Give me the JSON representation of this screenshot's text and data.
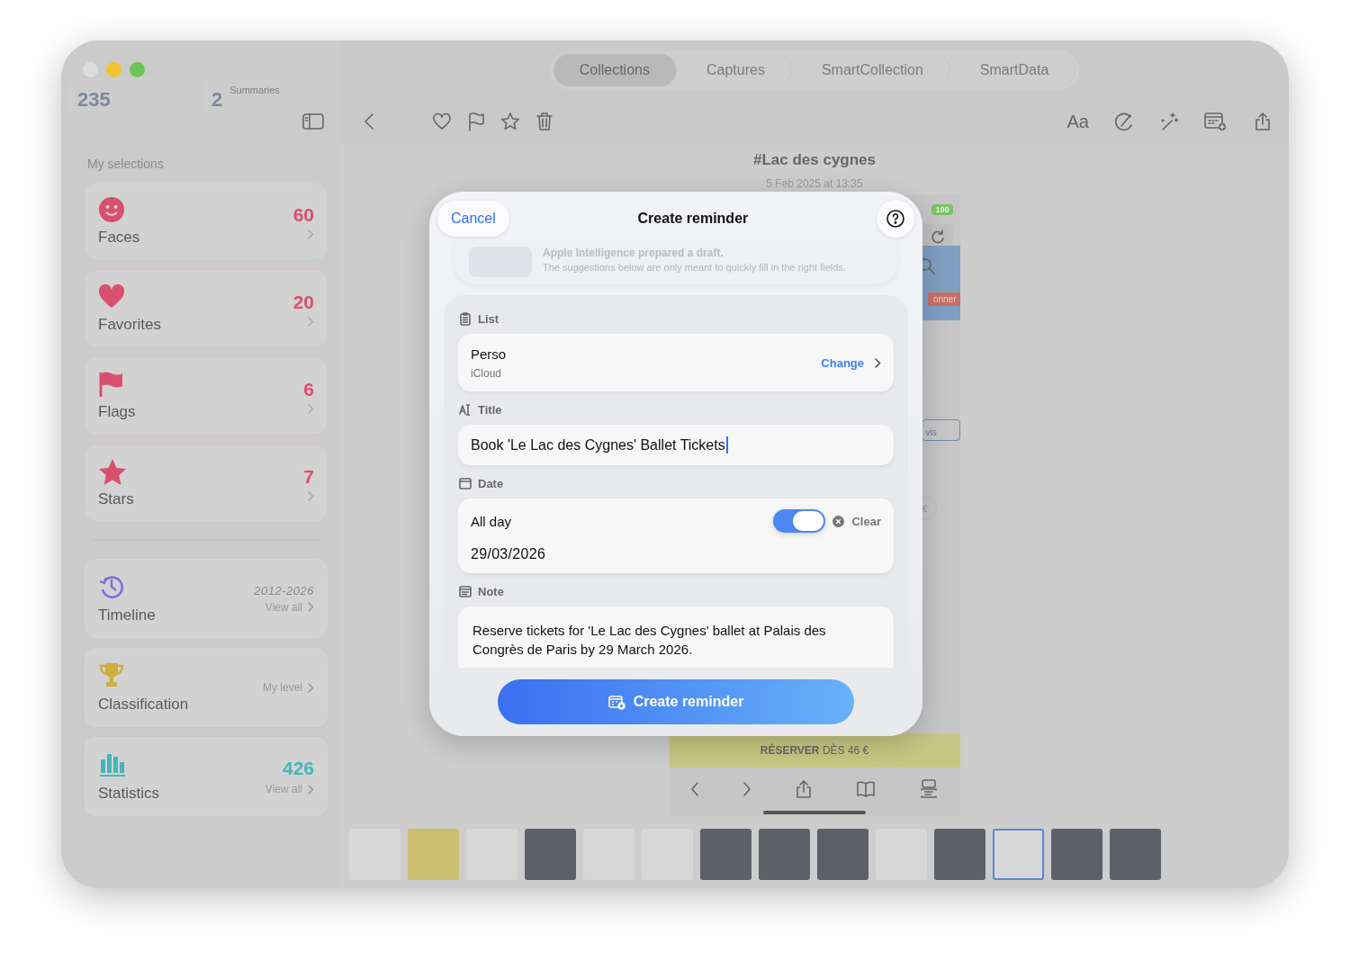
{
  "sidebar": {
    "stats": [
      {
        "value": "235"
      },
      {
        "label": "Summaries",
        "value": "2"
      }
    ],
    "section_title": "My selections",
    "selections": [
      {
        "label": "Faces",
        "count": "60",
        "kind": "smiley",
        "color": "#d9506e"
      },
      {
        "label": "Favorites",
        "count": "20",
        "kind": "heart",
        "color": "#d9506e"
      },
      {
        "label": "Flags",
        "count": "6",
        "kind": "flag",
        "color": "#d9506e"
      },
      {
        "label": "Stars",
        "count": "7",
        "kind": "star",
        "color": "#d9506e"
      }
    ],
    "tools": [
      {
        "label": "Timeline",
        "detail": "2012-2026",
        "link": "View all",
        "kind": "clock",
        "color": "#7d6fd8"
      },
      {
        "label": "Classification",
        "link": "My level",
        "kind": "trophy",
        "color": "#cfae3c"
      },
      {
        "label": "Statistics",
        "count": "426",
        "link": "View all",
        "kind": "bars",
        "color": "#45b5ba"
      }
    ]
  },
  "tabs": [
    {
      "label": "Collections",
      "selected": true
    },
    {
      "label": "Captures",
      "selected": false
    },
    {
      "label": "SmartCollection",
      "selected": false
    },
    {
      "label": "SmartData",
      "selected": false
    }
  ],
  "toolbar": {
    "text_size_label": "Aa"
  },
  "document": {
    "title": "#Lac des cygnes",
    "date": "5 Feb 2025 at 13:35"
  },
  "preview": {
    "badge": "100",
    "button_fragment": "onner",
    "link_fragment": "vis",
    "price_fragment": "€",
    "banner": "**RÉSERVER** DÈS 46 €"
  },
  "thumbnails": [
    {
      "kind": "light",
      "selected": false
    },
    {
      "kind": "yellow",
      "selected": false
    },
    {
      "kind": "light",
      "selected": false
    },
    {
      "kind": "dark",
      "selected": false
    },
    {
      "kind": "light",
      "selected": false
    },
    {
      "kind": "light",
      "selected": false
    },
    {
      "kind": "dark",
      "selected": false
    },
    {
      "kind": "dark",
      "selected": false
    },
    {
      "kind": "dark",
      "selected": false
    },
    {
      "kind": "light",
      "selected": false
    },
    {
      "kind": "dark",
      "selected": false
    },
    {
      "kind": "light",
      "selected": true
    },
    {
      "kind": "dark",
      "selected": false
    },
    {
      "kind": "dark",
      "selected": false
    }
  ],
  "dialog": {
    "cancel": "Cancel",
    "title": "Create reminder",
    "draft": {
      "heading": "Apple Intelligence prepared a draft.",
      "text": "The suggestions below are only meant to quickly fill in the right fields."
    },
    "list": {
      "label": "List",
      "name": "Perso",
      "account": "iCloud",
      "action": "Change"
    },
    "title_field": {
      "label": "Title",
      "value": "Book 'Le Lac des Cygnes' Ballet Tickets"
    },
    "date": {
      "label": "Date",
      "all_day_label": "All day",
      "all_day": true,
      "clear": "Clear",
      "value": "29/03/2026"
    },
    "note": {
      "label": "Note",
      "value": "Reserve tickets for 'Le Lac des Cygnes' ballet at Palais des Congrès de Paris by 29 March 2026."
    },
    "submit": "Create reminder"
  }
}
